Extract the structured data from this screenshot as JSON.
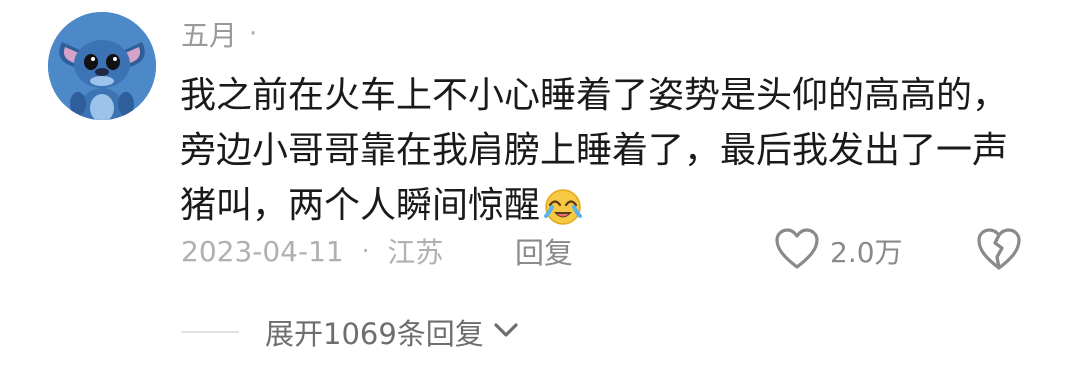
{
  "comment": {
    "username": "五月",
    "username_dot": "·",
    "text_lines": [
      "我之前在火车上不小心睡着了姿势是头仰的高高的，",
      "旁边小哥哥靠在我肩膀上睡着了，最后我发出了一声",
      "猪叫，两个人瞬间惊醒"
    ],
    "emoji": "laughing-crying-emoji",
    "date": "2023-04-11",
    "meta_separator": "·",
    "location": "江苏",
    "reply_label": "回复",
    "like_count": "2.0万",
    "expand_replies_label": "展开1069条回复"
  },
  "colors": {
    "text_primary": "#1a1a1a",
    "text_secondary": "#9a9a9a",
    "icon": "#8a8a8a",
    "avatar_bg": "#4a86c8"
  },
  "icons": {
    "like": "heart-outline-icon",
    "dislike": "broken-heart-icon",
    "expand": "chevron-down-icon"
  }
}
